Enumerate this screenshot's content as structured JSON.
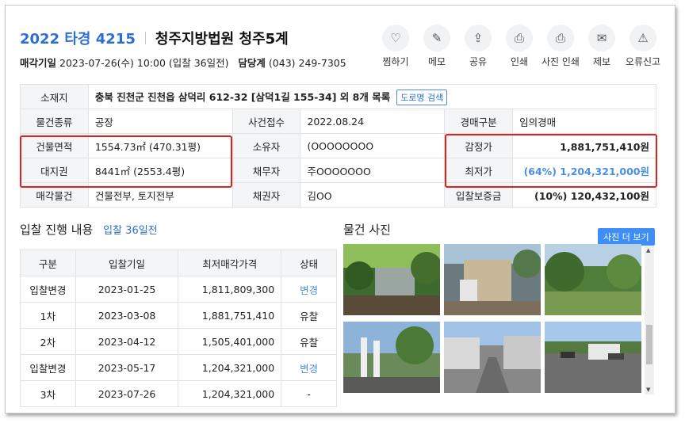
{
  "header": {
    "case_no": "2022 타경 4215",
    "court": "청주지방법원 청주5계",
    "sale_date_label": "매각기일",
    "sale_date_value": "2023-07-26(수) 10:00 (입찰 36일전)",
    "dept_label": "담당계",
    "dept_value": "(043) 249-7305"
  },
  "actions": [
    {
      "label": "찜하기",
      "icon": "heart-icon",
      "glyph": "♡"
    },
    {
      "label": "메모",
      "icon": "edit-icon",
      "glyph": "✎"
    },
    {
      "label": "공유",
      "icon": "share-icon",
      "glyph": "⇪"
    },
    {
      "label": "인쇄",
      "icon": "print-icon",
      "glyph": "⎙"
    },
    {
      "label": "사진 인쇄",
      "icon": "photo-print-icon",
      "glyph": "⎙"
    },
    {
      "label": "제보",
      "icon": "mail-icon",
      "glyph": "✉"
    },
    {
      "label": "오류신고",
      "icon": "report-icon",
      "glyph": "⚠"
    }
  ],
  "info": {
    "location_label": "소재지",
    "location_value": "충북 진천군 진천읍 삼덕리 612-32 [삼덕1길 155-34] 외 8개 목록",
    "road_button": "도로명 검색",
    "type_label": "물건종류",
    "type_value": "공장",
    "received_label": "사건접수",
    "received_value": "2022.08.24",
    "auction_kind_label": "경매구분",
    "auction_kind_value": "임의경매",
    "building_area_label": "건물면적",
    "building_area_value": "1554.73㎡ (470.31평)",
    "owner_label": "소유자",
    "owner_value": "(OOOOOOOO",
    "appraisal_label": "감정가",
    "appraisal_value": "1,881,751,410원",
    "land_right_label": "대지권",
    "land_right_value": "8441㎡ (2553.4평)",
    "debtor_label": "채무자",
    "debtor_value": "주OOOOOOO",
    "min_price_label": "최저가",
    "min_price_value": "(64%) 1,204,321,000원",
    "sale_item_label": "매각물건",
    "sale_item_value": "건물전부, 토지전부",
    "creditor_label": "채권자",
    "creditor_value": "김OO",
    "deposit_label": "입찰보증금",
    "deposit_value": "(10%) 120,432,100원"
  },
  "bids": {
    "title": "입찰 진행 내용",
    "subtitle": "입찰 36일전",
    "columns": [
      "구분",
      "입찰기일",
      "최저매각가격",
      "상태"
    ],
    "rows": [
      {
        "kind": "입찰변경",
        "date": "2023-01-25",
        "price": "1,811,809,300",
        "status": "변경"
      },
      {
        "kind": "1차",
        "date": "2023-03-08",
        "price": "1,881,751,410",
        "status": "유찰"
      },
      {
        "kind": "2차",
        "date": "2023-04-12",
        "price": "1,505,401,000",
        "status": "유찰"
      },
      {
        "kind": "입찰변경",
        "date": "2023-05-17",
        "price": "1,204,321,000",
        "status": "변경"
      },
      {
        "kind": "3차",
        "date": "2023-07-26",
        "price": "1,204,321,000",
        "status": "-"
      }
    ]
  },
  "photos": {
    "title": "물건 사진",
    "more_button": "사진 더 보기"
  },
  "colors": {
    "accent": "#2b6fd6",
    "highlight_box": "#e02020",
    "blue_status": "#4a8fe0"
  }
}
